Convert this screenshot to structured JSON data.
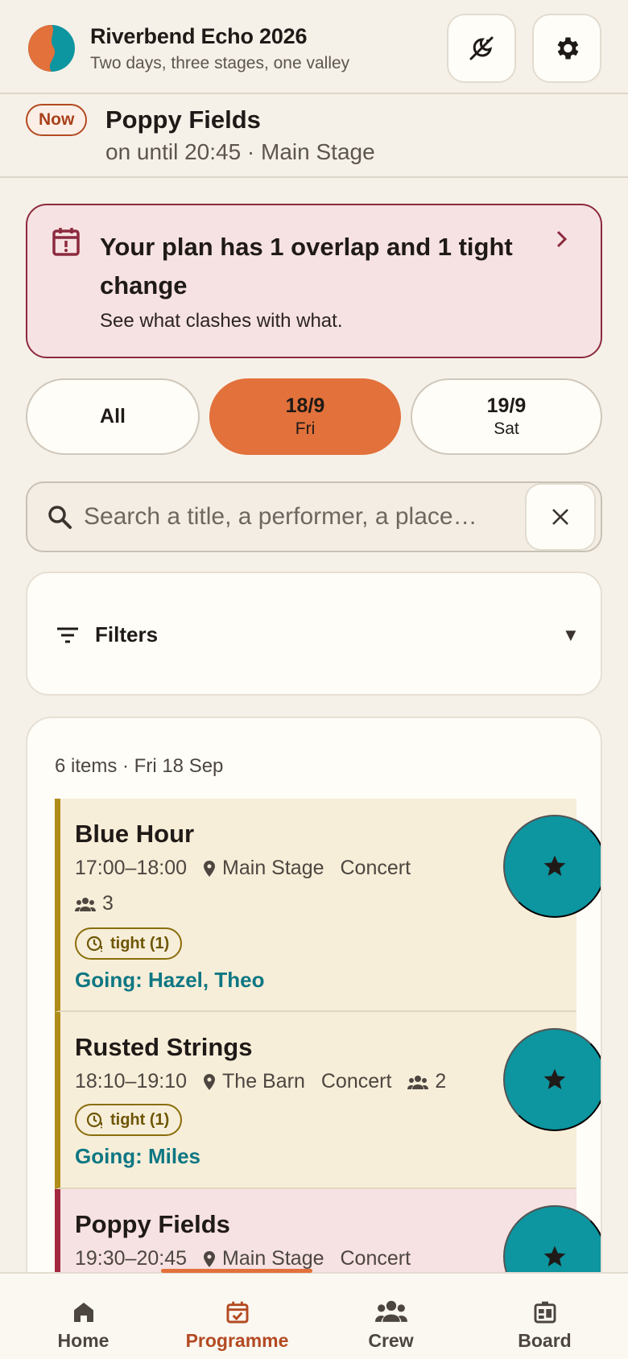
{
  "header": {
    "title": "Riverbend Echo 2026",
    "subtitle": "Two days, three stages, one valley",
    "icons": [
      "theme-toggle-icon",
      "gear-icon"
    ]
  },
  "now": {
    "badge": "Now",
    "title": "Poppy Fields",
    "subtitle": "on until 20:45 · Main Stage"
  },
  "alert": {
    "title": "Your plan has 1 overlap and 1 tight change",
    "subtitle": "See what clashes with what."
  },
  "days": [
    {
      "label": "All",
      "sub": ""
    },
    {
      "label": "18/9",
      "sub": "Fri"
    },
    {
      "label": "19/9",
      "sub": "Sat"
    }
  ],
  "search": {
    "placeholder": "Search a title, a performer, a place…"
  },
  "filters": {
    "label": "Filters"
  },
  "list": {
    "summary": "6 items · Fri 18 Sep",
    "events": [
      {
        "title": "Blue Hour",
        "time": "17:00–18:00",
        "place": "Main Stage",
        "type": "Concert",
        "crew": "3",
        "badge": "tight (1)",
        "going": "Going: Hazel, Theo"
      },
      {
        "title": "Rusted Strings",
        "time": "18:10–19:10",
        "place": "The Barn",
        "type": "Concert",
        "crew": "2",
        "badge": "tight (1)",
        "going": "Going: Miles"
      },
      {
        "title": "Poppy Fields",
        "time": "19:30–20:45",
        "place": "Main Stage",
        "type": "Concert"
      }
    ]
  },
  "nav": [
    {
      "label": "Home",
      "icon": "home-icon"
    },
    {
      "label": "Programme",
      "icon": "calendar-check-icon"
    },
    {
      "label": "Crew",
      "icon": "people-icon"
    },
    {
      "label": "Board",
      "icon": "board-icon"
    }
  ],
  "colors": {
    "accent": "#e2713b",
    "teal": "#0d95a0",
    "alert_border": "#8c2a3e",
    "tight": "#b08d1a"
  }
}
